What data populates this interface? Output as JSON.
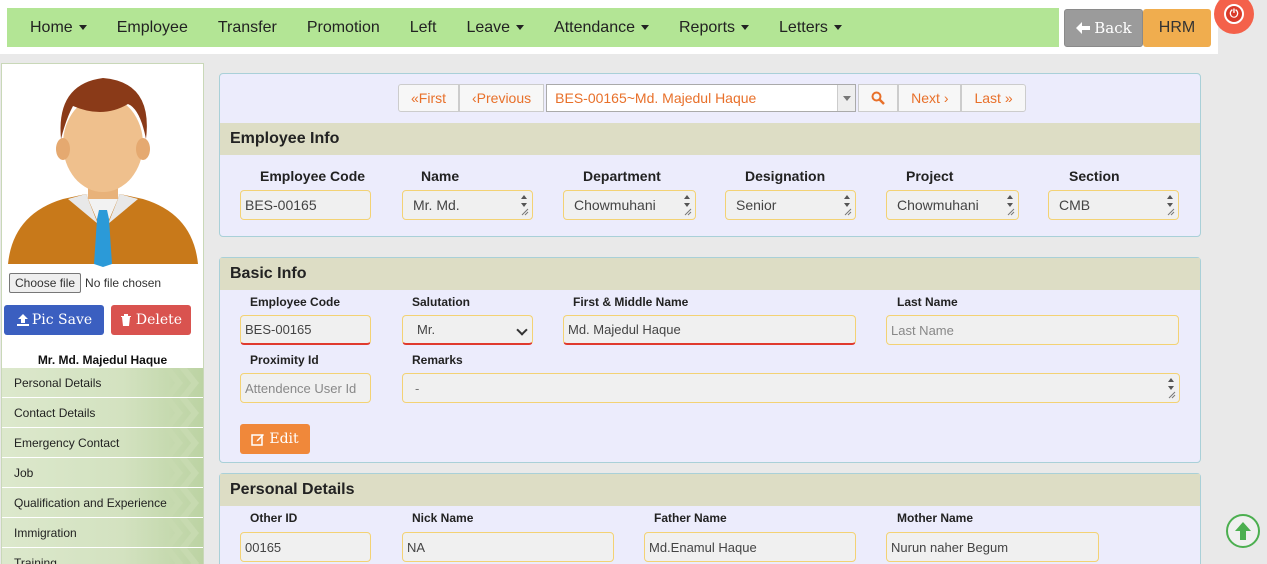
{
  "nav": {
    "items": [
      {
        "label": "Home",
        "caret": true
      },
      {
        "label": "Employee",
        "caret": false
      },
      {
        "label": "Transfer",
        "caret": false
      },
      {
        "label": "Promotion",
        "caret": false
      },
      {
        "label": "Left",
        "caret": false
      },
      {
        "label": "Leave",
        "caret": true
      },
      {
        "label": "Attendance",
        "caret": true
      },
      {
        "label": "Reports",
        "caret": true
      },
      {
        "label": "Letters",
        "caret": true
      }
    ],
    "back_label": "Back",
    "hrm_label": "HRM"
  },
  "sidebar": {
    "file_button": "Choose file",
    "file_status": "No file chosen",
    "pic_save_label": "Pic Save",
    "delete_label": "Delete",
    "employee_name": "Mr. Md. Majedul Haque",
    "menu": [
      "Personal Details",
      "Contact Details",
      "Emergency Contact",
      "Job",
      "Qualification and Experience",
      "Immigration",
      "Training"
    ]
  },
  "pager": {
    "first": "«First",
    "previous": "‹Previous",
    "selected": "BES-00165~Md. Majedul Haque",
    "next": "Next ›",
    "last": "Last »"
  },
  "employee_info": {
    "title": "Employee Info",
    "labels": [
      "Employee Code",
      "Name",
      "Department",
      "Designation",
      "Project",
      "Section"
    ],
    "values": [
      "BES-00165",
      "Mr. Md.",
      "Chowmuhani",
      "Senior",
      "Chowmuhani",
      "CMB"
    ]
  },
  "basic_info": {
    "title": "Basic Info",
    "employee_code_label": "Employee Code",
    "employee_code": "BES-00165",
    "salutation_label": "Salutation",
    "salutation": "Mr.",
    "first_middle_label": "First & Middle Name",
    "first_middle": "Md. Majedul Haque",
    "last_name_label": "Last Name",
    "last_name_placeholder": "Last Name",
    "proximity_label": "Proximity Id",
    "proximity_placeholder": "Attendence User Id",
    "remarks_label": "Remarks",
    "remarks": "-",
    "edit_label": "Edit"
  },
  "personal_details": {
    "title": "Personal Details",
    "other_id_label": "Other ID",
    "other_id": "00165",
    "nick_name_label": "Nick Name",
    "nick_name": "NA",
    "father_label": "Father Name",
    "father": "Md.Enamul Haque",
    "mother_label": "Mother Name",
    "mother": "Nurun naher Begum"
  }
}
